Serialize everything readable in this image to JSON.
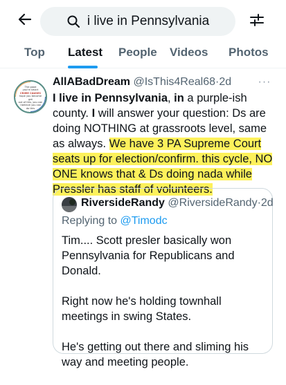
{
  "search": {
    "query": "i live in Pennsylvania"
  },
  "tabs": [
    {
      "label": "Top"
    },
    {
      "label": "Latest"
    },
    {
      "label": "People"
    },
    {
      "label": "Videos"
    },
    {
      "label": "Photos"
    }
  ],
  "active_tab": "Latest",
  "colors": {
    "accent": "#1d9bf0",
    "highlight": "#fdf15b",
    "muted_text": "#536471"
  },
  "tweet": {
    "display_name": "AllABadDream",
    "handle": "@IsThis4Real68",
    "time": "2d",
    "more": "···",
    "avatar_text": {
      "line1": "The good",
      "line2": "you're smart",
      "line3": "CRIME CAUSES",
      "line4": "hope you become get",
      "line5": "out of this, you can",
      "line6": "I believe you can",
      "line7": "do this"
    },
    "body": {
      "p1_bold": "I live in Pennsylvania",
      "p1_sep": ", ",
      "p1_bold2": "in",
      "p1_rest": " a purple-ish county. ",
      "p1_bold3": "I",
      "p2": " will answer your question: Ds are doing NOTHING at grassroots level, same as always.",
      "highlighted": "We have 3 PA Supreme Court seats up for election/confirm. this cycle, NO ONE knows that & Ds doing nada while Pressler has staff of volunteers."
    }
  },
  "quoted": {
    "display_name": "RiversideRandy",
    "handle": "@RiversideRandy",
    "time": "2d",
    "replying_prefix": "Replying to",
    "replying_to": "@Timodc",
    "paragraphs": [
      "Tim.... Scott presler basically won Pennsylvania for Republicans and Donald.",
      "Right now he's holding townhall meetings in swing States.",
      "He's getting out there and sliming his way and meeting people."
    ]
  }
}
